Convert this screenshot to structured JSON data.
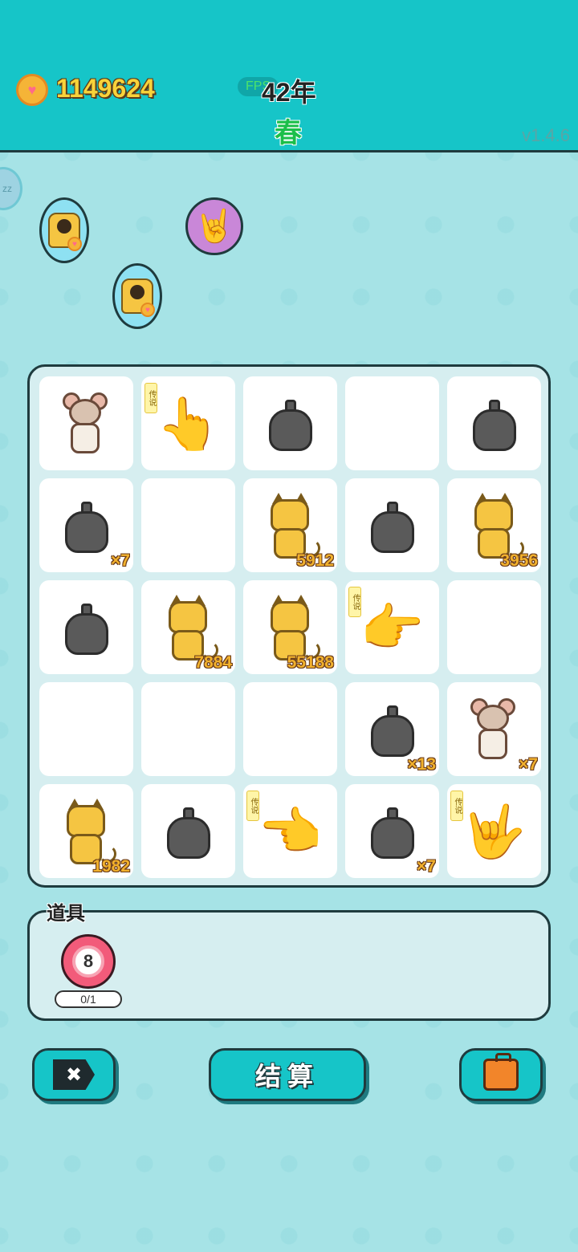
{
  "header": {
    "coins": "1149624",
    "fps_label": "FPS",
    "year": "42年",
    "season": "春",
    "version": "v1.4.6",
    "sleep_label": "zz"
  },
  "buffs": [
    {
      "type": "cat"
    },
    {
      "type": "cat"
    },
    {
      "type": "hand"
    }
  ],
  "board": {
    "legend_tag": "传说",
    "cells": [
      {
        "item": "mouse",
        "count": ""
      },
      {
        "item": "hand",
        "legend": true,
        "glyph": "👆",
        "count": ""
      },
      {
        "item": "bag",
        "count": ""
      },
      {
        "item": "empty",
        "count": ""
      },
      {
        "item": "bag",
        "count": ""
      },
      {
        "item": "bag",
        "count": "×7"
      },
      {
        "item": "empty",
        "count": ""
      },
      {
        "item": "cat",
        "count": "5912"
      },
      {
        "item": "bag",
        "count": ""
      },
      {
        "item": "cat",
        "count": "3956"
      },
      {
        "item": "bag",
        "count": ""
      },
      {
        "item": "cat",
        "count": "7884"
      },
      {
        "item": "cat",
        "count": "55188"
      },
      {
        "item": "hand",
        "legend": true,
        "glyph": "👉",
        "count": ""
      },
      {
        "item": "empty",
        "count": ""
      },
      {
        "item": "empty",
        "count": ""
      },
      {
        "item": "empty",
        "count": ""
      },
      {
        "item": "empty",
        "count": ""
      },
      {
        "item": "bag",
        "count": "×13"
      },
      {
        "item": "mouse",
        "count": "×7"
      },
      {
        "item": "cat",
        "count": "1982"
      },
      {
        "item": "bag",
        "count": ""
      },
      {
        "item": "hand",
        "legend": true,
        "glyph": "👈",
        "count": ""
      },
      {
        "item": "bag",
        "count": "×7"
      },
      {
        "item": "hand",
        "legend": true,
        "glyph": "🤟",
        "count": ""
      }
    ]
  },
  "props": {
    "title": "道具",
    "ball_number": "8",
    "ball_count": "0/1"
  },
  "actions": {
    "close_glyph": "✖",
    "settle_label": "结算"
  }
}
